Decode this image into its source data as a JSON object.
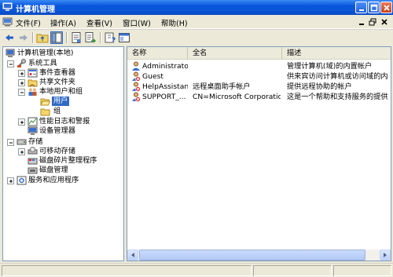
{
  "window": {
    "title": "计算机管理"
  },
  "menubar": {
    "items": [
      "文件(F)",
      "操作(A)",
      "查看(V)",
      "窗口(W)",
      "帮助(H)"
    ]
  },
  "tree": {
    "root": "计算机管理(本地)",
    "system_tools": "系统工具",
    "event_viewer": "事件查看器",
    "shared_folders": "共享文件夹",
    "local_users_groups": "本地用户和组",
    "users": "用户",
    "groups": "组",
    "perf_logs": "性能日志和警报",
    "device_manager": "设备管理器",
    "storage": "存储",
    "removable_storage": "可移动存储",
    "disk_defrag": "磁盘碎片整理程序",
    "disk_management": "磁盘管理",
    "services_apps": "服务和应用程序"
  },
  "list": {
    "headers": [
      "名称",
      "全名",
      "描述"
    ],
    "rows": [
      {
        "name": "Administrator",
        "fullname": "",
        "desc": "管理计算机(域)的内置帐户"
      },
      {
        "name": "Guest",
        "fullname": "",
        "desc": "供来宾访问计算机或访问域的内"
      },
      {
        "name": "HelpAssistant",
        "fullname": "远程桌面助手帐户",
        "desc": "提供远程协助的帐户"
      },
      {
        "name": "SUPPORT_...",
        "fullname": "CN=Microsoft Corporatio...",
        "desc": "这是一个帮助和支持服务的提供"
      }
    ]
  },
  "colors": {
    "titlebar": "#0855dd",
    "selection": "#316ac5",
    "chrome": "#ece9d8"
  }
}
